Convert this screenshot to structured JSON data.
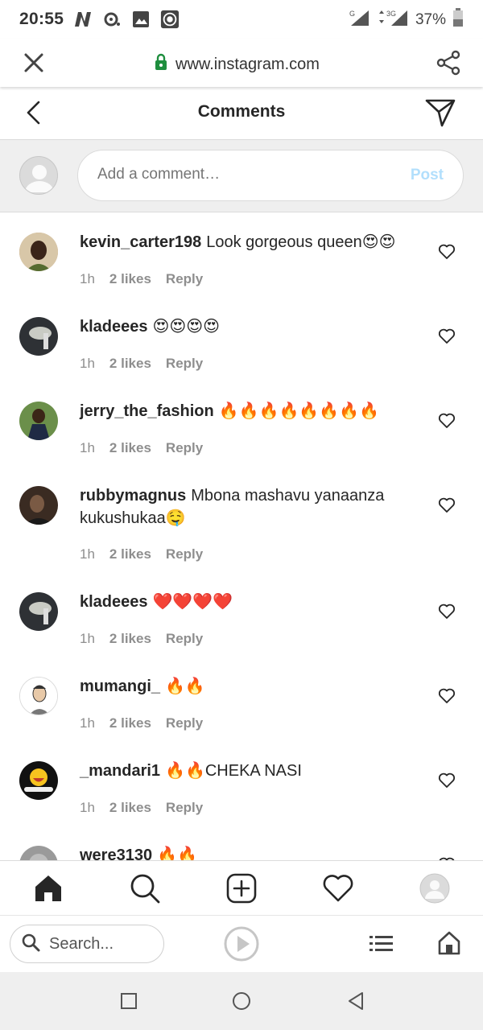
{
  "status_bar": {
    "time": "20:55",
    "battery": "37%",
    "network": "3G"
  },
  "browser": {
    "url": "www.instagram.com"
  },
  "header": {
    "title": "Comments"
  },
  "composer": {
    "placeholder": "Add a comment…",
    "post_label": "Post"
  },
  "comments": [
    {
      "user": "kevin_carter198",
      "text": "Look gorgeous queen😍😍",
      "time": "1h",
      "likes": "2 likes",
      "reply": "Reply"
    },
    {
      "user": "kladeees",
      "text": "😍😍😍😍",
      "time": "1h",
      "likes": "2 likes",
      "reply": "Reply"
    },
    {
      "user": "jerry_the_fashion",
      "text": "🔥🔥🔥🔥🔥🔥🔥🔥",
      "time": "1h",
      "likes": "2 likes",
      "reply": "Reply"
    },
    {
      "user": "rubbymagnus",
      "text": "Mbona mashavu yanaanza kukushukaa🤤",
      "time": "1h",
      "likes": "2 likes",
      "reply": "Reply"
    },
    {
      "user": "kladeees",
      "text": "❤️❤️❤️❤️",
      "time": "1h",
      "likes": "2 likes",
      "reply": "Reply"
    },
    {
      "user": "mumangi_",
      "text": "🔥🔥",
      "time": "1h",
      "likes": "2 likes",
      "reply": "Reply"
    },
    {
      "user": "_mandari1",
      "text": "🔥🔥CHEKA NASI",
      "time": "1h",
      "likes": "2 likes",
      "reply": "Reply"
    },
    {
      "user": "were3130",
      "text": "🔥🔥",
      "time": "",
      "likes": "",
      "reply": ""
    }
  ],
  "browser_bottom": {
    "search_label": "Search..."
  },
  "colors": {
    "post_disabled": "#b2dffc",
    "meta_gray": "#8e8e8e",
    "text": "#262626"
  }
}
